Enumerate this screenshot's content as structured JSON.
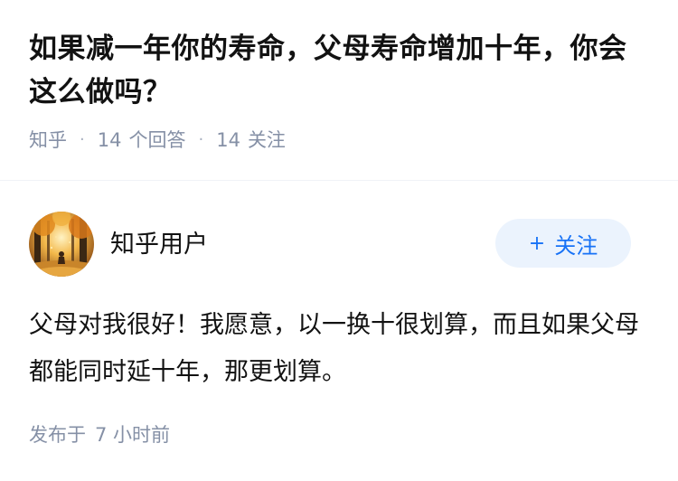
{
  "question": {
    "title": "如果减一年你的寿命，父母寿命增加十年，你会这么做吗？",
    "source": "知乎",
    "separator": "·",
    "answer_count": "14",
    "answer_label": "个回答",
    "follow_count": "14",
    "follow_label": "关注"
  },
  "author": {
    "name": "知乎用户",
    "avatar_icon": "avatar-autumn-forest-icon",
    "follow_plus": "+",
    "follow_label": "关注"
  },
  "answer": {
    "content": "父母对我很好！我愿意，以一换十很划算，而且如果父母都能同时延十年，那更划算。",
    "published_label": "发布于",
    "published_time": "7 小时前"
  },
  "colors": {
    "accent": "#1772f6",
    "accent_bg": "#ebf3fd",
    "meta": "#8590a6",
    "text": "#121212"
  }
}
